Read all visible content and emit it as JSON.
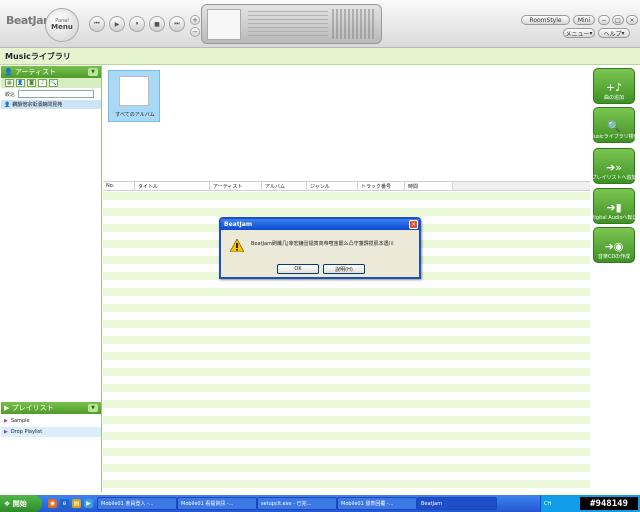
{
  "player": {
    "logo": "BeatJam",
    "panel_top": "Panel",
    "panel_menu": "Menu",
    "room_style": "RoomStyle",
    "mini": "Mini",
    "menu": "メニュー",
    "help": "ヘルプ"
  },
  "library_title": "Musicライブラリ",
  "artist_panel": {
    "header": "アーティスト",
    "filter_label": "絞込",
    "filter_value": "",
    "selected_item": "鑽韻倍宗衒濱娘問見苑"
  },
  "playlist_panel": {
    "header": "プレイリスト",
    "items": [
      "Sample",
      "Drop Playlist"
    ]
  },
  "album_tile": "すべてのアルバム",
  "track_columns": [
    "No.",
    "タイトル",
    "アーティスト",
    "アルバム",
    "ジャンル",
    "トラック番号",
    "時間"
  ],
  "actions": [
    {
      "icon": "+♪",
      "label": "曲の追加"
    },
    {
      "icon": "🔍",
      "label": "Musicライブラリ検索"
    },
    {
      "icon": "➔»",
      "label": "プレイリストへ追加"
    },
    {
      "icon": "➔▮",
      "label": "Digital Audioへ転送"
    },
    {
      "icon": "➔◉",
      "label": "音楽CDの作成"
    }
  ],
  "dialog": {
    "title": "BeatJam",
    "message": "BeatJam刷纖几|宰宏鐘晉镭寅商帝喧宙罷么凸守藩霹揽肌本遇川",
    "ok": "OK",
    "help": "說明(H)"
  },
  "taskbar": {
    "start": "開始",
    "tasks": [
      "Mobile01 會員登入 -...",
      "Mobile01 看提資訊 -...",
      "setupclt.exe - 已完...",
      "Mobile01 發表回覆 -...",
      "BeatJam"
    ],
    "tray_lang": "CH"
  },
  "watermark": "#948149"
}
